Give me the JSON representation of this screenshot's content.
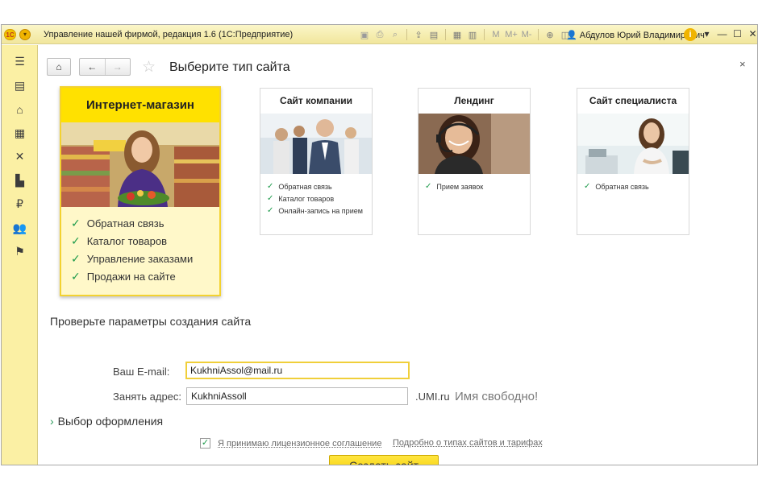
{
  "window": {
    "title": "Управление нашей фирмой, редакция 1.6  (1С:Предприятие)",
    "logo_text": "1С",
    "user": "Абдулов Юрий Владимирович"
  },
  "toolbar_icons": [
    "save-icon",
    "print-icon",
    "print-preview-icon",
    "upload-icon",
    "document-icon",
    "calculator-icon",
    "calendar-icon",
    "M",
    "M+",
    "M-",
    "zoom-icon",
    "panel-icon"
  ],
  "sidebar": {
    "items": [
      "menu-icon",
      "desktop-icon",
      "purchases-icon",
      "warehouse-icon",
      "tools-icon",
      "production-icon",
      "money-icon",
      "users-icon",
      "flag-icon"
    ]
  },
  "page": {
    "title": "Выберите тип сайта"
  },
  "cards": [
    {
      "title": "Интернет-магазин",
      "selected": true,
      "features": [
        "Обратная связь",
        "Каталог товаров",
        "Управление заказами",
        "Продажи на сайте"
      ]
    },
    {
      "title": "Сайт компании",
      "selected": false,
      "features": [
        "Обратная связь",
        "Каталог товаров",
        "Онлайн-запись на прием"
      ]
    },
    {
      "title": "Лендинг",
      "selected": false,
      "features": [
        "Прием заявок"
      ]
    },
    {
      "title": "Сайт специалиста",
      "selected": false,
      "features": [
        "Обратная связь"
      ]
    }
  ],
  "form": {
    "section_title": "Проверьте параметры создания сайта",
    "email_label": "Ваш E-mail:",
    "email_value": "KukhniAssol@mail.ru",
    "address_label": "Занять адрес:",
    "address_value": "KukhniAssoll",
    "domain_suffix": ".UMI.ru",
    "availability": "Имя свободно!",
    "design_toggle": "Выбор оформления",
    "agree_checked": true,
    "agree_label": "Я принимаю лицензионное  соглашение",
    "more_link": "Подробно о типах сайтов и тарифах",
    "create_button": "Создать сайт"
  },
  "colors": {
    "accent_yellow": "#ffe100",
    "sidebar_bg": "#fbf0a4",
    "check_green": "#1c9a4a"
  }
}
